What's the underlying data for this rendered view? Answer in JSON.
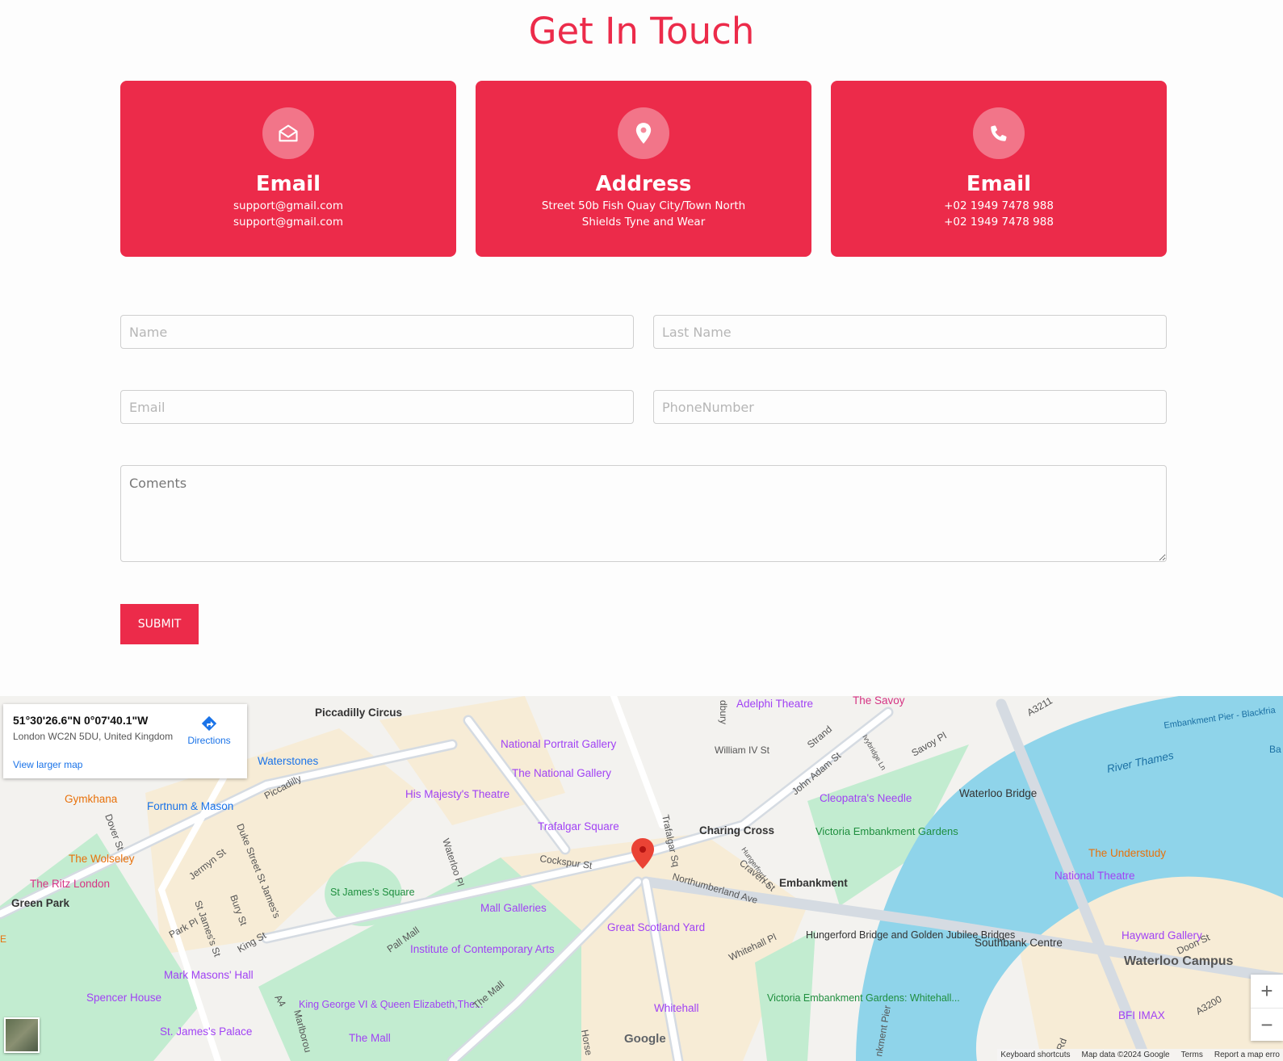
{
  "page_title": "Get In Touch",
  "cards": [
    {
      "icon": "envelope-open-icon",
      "title": "Email",
      "line1": "support@gmail.com",
      "line2": "support@gmail.com"
    },
    {
      "icon": "map-pin-icon",
      "title": "Address",
      "line1": "Street 50b Fish Quay City/Town North",
      "line2": "Shields Tyne and Wear"
    },
    {
      "icon": "phone-icon",
      "title": "Email",
      "line1": "+02 1949 7478 988",
      "line2": "+02 1949 7478 988"
    }
  ],
  "form": {
    "name_placeholder": "Name",
    "last_name_placeholder": "Last Name",
    "email_placeholder": "Email",
    "phone_placeholder": "PhoneNumber",
    "comments_placeholder": "Coments",
    "submit_label": "SUBMIT"
  },
  "colors": {
    "accent": "#ec2b4a",
    "water": "#8fd4ea",
    "park": "#c2ecd0",
    "poi": "#a142f4"
  },
  "map": {
    "infobox": {
      "coordinates": "51°30'26.6\"N 0°07'40.1\"W",
      "address": "London WC2N 5DU, United Kingdom",
      "directions_label": "Directions",
      "larger_map_label": "View larger map"
    },
    "labels": {
      "piccadilly_circus": "Piccadilly Circus",
      "adelphi": "Adelphi Theatre",
      "savoy": "The Savoy",
      "npg": "National Portrait Gallery",
      "william_iv": "William IV St",
      "strand": "Strand",
      "waterstones": "Waterstones",
      "national_gallery": "The National Gallery",
      "gymkhana": "Gymkhana",
      "fortnum": "Fortnum & Mason",
      "piccadilly": "Piccadilly",
      "his_majestys": "His Majesty's Theatre",
      "john_adam": "John Adam St",
      "cleopatra": "Cleopatra's Needle",
      "waterloo_bridge": "Waterloo Bridge",
      "river_thames": "River Thames",
      "embankment_pier": "Embankment Pier - Blackfria",
      "savoy_pl": "Savoy Pl",
      "a3211": "A3211",
      "trafalgar_square": "Trafalgar Square",
      "charing_cross": "Charing Cross",
      "wolseley": "The Wolseley",
      "ritz": "The Ritz London",
      "green_park": "Green Park",
      "dover_st": "Dover St",
      "jermyn_st": "Jermyn St",
      "duke_st": "Duke Street St James's",
      "st_james_sq": "St James's Square",
      "waterloo_pl": "Waterloo Pl",
      "cockspur": "Cockspur St",
      "trafalgar_sq_st": "Trafalgar Sq",
      "northumberland": "Northumberland Ave",
      "craven": "Craven St",
      "veg": "Victoria Embankment Gardens",
      "embankment": "Embankment",
      "understudy": "The Understudy",
      "national_theatre": "National Theatre",
      "mall_galleries": "Mall Galleries",
      "pall_mall": "Pall Mall",
      "great_scotland": "Great Scotland Yard",
      "hungerford": "Hungerford Bridge and Golden Jubilee Bridges",
      "southbank": "Southbank Centre",
      "hayward": "Hayward Gallery",
      "waterloo_campus": "Waterloo Campus",
      "ica": "Institute of Contemporary Arts",
      "whitehall_pl": "Whitehall Pl",
      "doon_st": "Doon St",
      "mark_masons": "Mark Masons' Hall",
      "spencer": "Spencer House",
      "king_george": "King George VI & Queen Elizabeth,The...",
      "the_mall_road": "The Mall",
      "whitehall": "Whitehall",
      "veg_whitehall": "Victoria Embankment Gardens: Whitehall...",
      "bfi": "BFI IMAX",
      "a3200": "A3200",
      "st_james_palace": "St. James's Palace",
      "the_mall_poi": "The Mall",
      "king_st": "King St",
      "bury_st": "Bury St",
      "park_pl": "Park Pl",
      "st_jamess_st": "St James's St",
      "a4": "A4",
      "marlborough": "Marlborou",
      "horse": "Horse",
      "nkment_pier": "nkment Pier",
      "rd": "Rd",
      "ivybridge": "Ivybridge Ln",
      "hungerford_ln": "Hungerford Ln",
      "dbury": "dbury",
      "e_edge": "E",
      "ba": "Ba"
    },
    "footer": {
      "shortcuts": "Keyboard shortcuts",
      "map_data": "Map data ©2024 Google",
      "terms": "Terms",
      "report": "Report a map erro"
    },
    "google_logo": "Google",
    "zoom_in": "+",
    "zoom_out": "−"
  }
}
